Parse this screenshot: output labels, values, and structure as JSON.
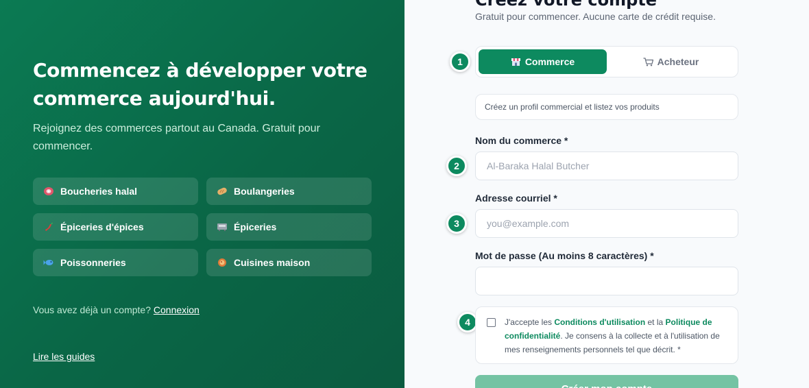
{
  "left": {
    "title": "Commencez à développer votre commerce aujourd'hui.",
    "subtitle": "Rejoignez des commerces partout au Canada. Gratuit pour commencer.",
    "categories": [
      {
        "label": "Boucheries halal",
        "icon": "meat-icon"
      },
      {
        "label": "Boulangeries",
        "icon": "bread-icon"
      },
      {
        "label": "Épiceries d'épices",
        "icon": "chili-icon"
      },
      {
        "label": "Épiceries",
        "icon": "grocery-icon"
      },
      {
        "label": "Poissonneries",
        "icon": "fish-icon"
      },
      {
        "label": "Cuisines maison",
        "icon": "food-bowl-icon"
      }
    ],
    "login_prompt": "Vous avez déjà un compte?",
    "login_link": "Connexion",
    "guides_link": "Lire les guides"
  },
  "form": {
    "title": "Créez votre compte",
    "subtitle": "Gratuit pour commencer. Aucune carte de crédit requise.",
    "steps": [
      "1",
      "2",
      "3",
      "4"
    ],
    "account_types": [
      {
        "label": "Commerce",
        "icon": "store-icon",
        "active": true
      },
      {
        "label": "Acheteur",
        "icon": "cart-icon",
        "active": false
      }
    ],
    "hint": "Créez un profil commercial et listez vos produits",
    "business_name": {
      "label": "Nom du commerce *",
      "placeholder": "Al-Baraka Halal Butcher",
      "value": ""
    },
    "email": {
      "label": "Adresse courriel *",
      "placeholder": "you@example.com",
      "value": ""
    },
    "password": {
      "label": "Mot de passe (Au moins 8 caractères) *",
      "value": ""
    },
    "terms": {
      "checked": false,
      "text_1": "J'accepte les ",
      "link_terms": "Conditions d'utilisation",
      "text_2": " et la ",
      "link_privacy": "Politique de confidentialité",
      "text_3": ". Je consens à la collecte et à l'utilisation de mes renseignements personnels tel que décrit. *"
    },
    "submit_label": "Créer mon compte"
  },
  "colors": {
    "brand": "#0d8a5f",
    "left_panel": "#0a6646",
    "submit_disabled": "#74c3a3"
  }
}
